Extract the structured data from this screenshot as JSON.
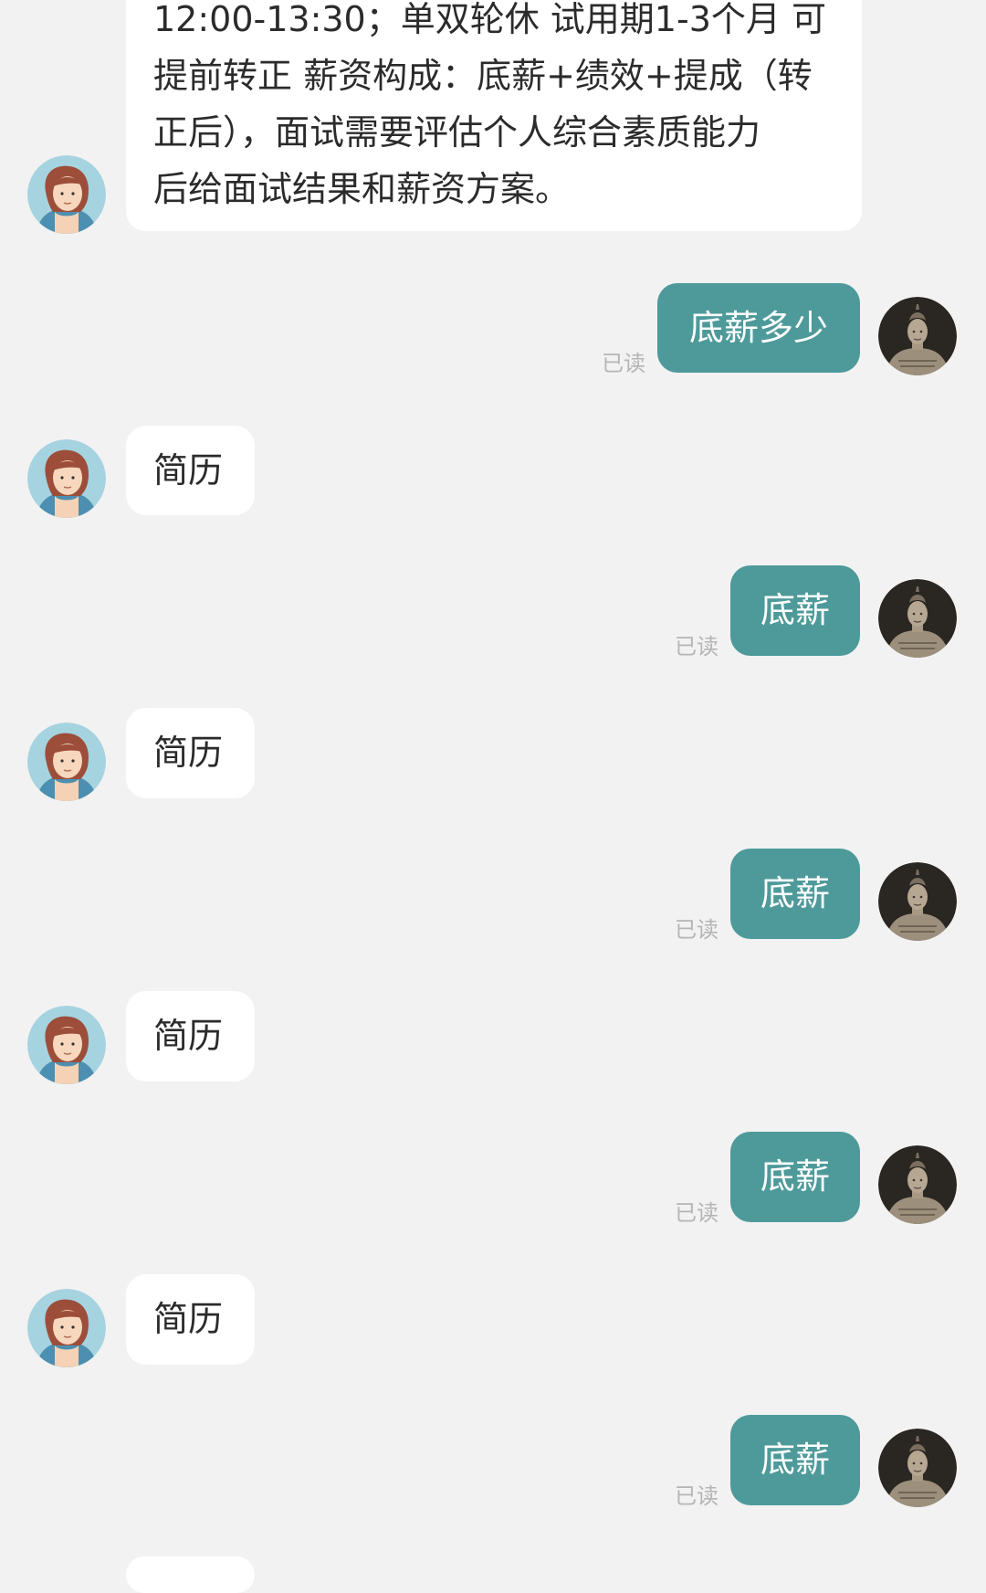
{
  "conversation": {
    "first_message": "12:00-13:30；单双轮休 试用期1-3个月 可\n提前转正 薪资构成：底薪+绩效+提成（转\n正后），面试需要评估个人综合素质能力\n后给面试结果和薪资方案。",
    "reply_1": "底薪多少",
    "resume_1": "简历",
    "reply_2": "底薪",
    "resume_2": "简历",
    "reply_3": "底薪",
    "resume_3": "简历",
    "reply_4": "底薪",
    "resume_4": "简历",
    "reply_5": "底薪",
    "read_label": "已读"
  },
  "colors": {
    "background": "#f2f2f2",
    "incoming_bubble": "#ffffff",
    "outgoing_bubble": "#4e9a9a",
    "read_text": "#b5b5b5"
  },
  "icons": {
    "recruiter_avatar": "woman-cartoon-avatar",
    "user_avatar": "terracotta-warrior-photo-avatar"
  }
}
